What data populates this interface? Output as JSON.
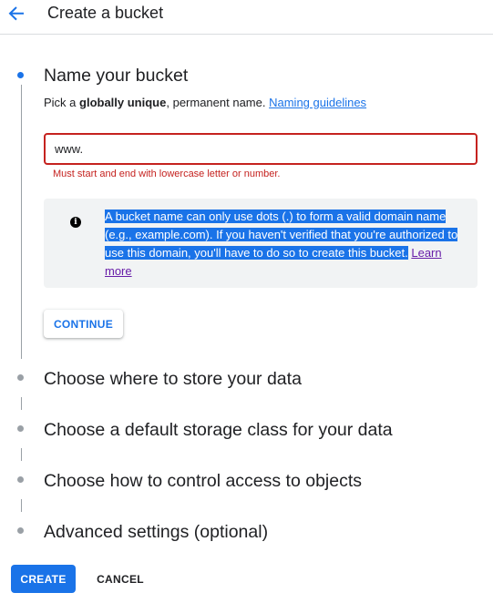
{
  "header": {
    "title": "Create a bucket",
    "back_icon": "arrow-back-icon"
  },
  "steps": [
    {
      "title": "Name your bucket",
      "active": true
    },
    {
      "title": "Choose where to store your data",
      "active": false
    },
    {
      "title": "Choose a default storage class for your data",
      "active": false
    },
    {
      "title": "Choose how to control access to objects",
      "active": false
    },
    {
      "title": "Advanced settings (optional)",
      "active": false
    }
  ],
  "name_step": {
    "hint_prefix": "Pick a ",
    "hint_bold": "globally unique",
    "hint_suffix": ", permanent name.",
    "hint_link": "Naming guidelines",
    "input_value": "www.",
    "error": "Must start and end with lowercase letter or number.",
    "info_icon": "info-icon",
    "info_text": "A bucket name can only use dots (.) to form a valid domain name (e.g., example.com). If you haven't verified that you're authorized to use this domain, you'll have to do so to create this bucket.",
    "info_link": "Learn more",
    "continue_label": "CONTINUE"
  },
  "footer": {
    "create_label": "CREATE",
    "cancel_label": "CANCEL"
  },
  "colors": {
    "accent": "#1a73e8",
    "error": "#c5221f",
    "selection": "#1a73e8",
    "info_bg": "#f1f3f4",
    "visited_link": "#681da8"
  }
}
